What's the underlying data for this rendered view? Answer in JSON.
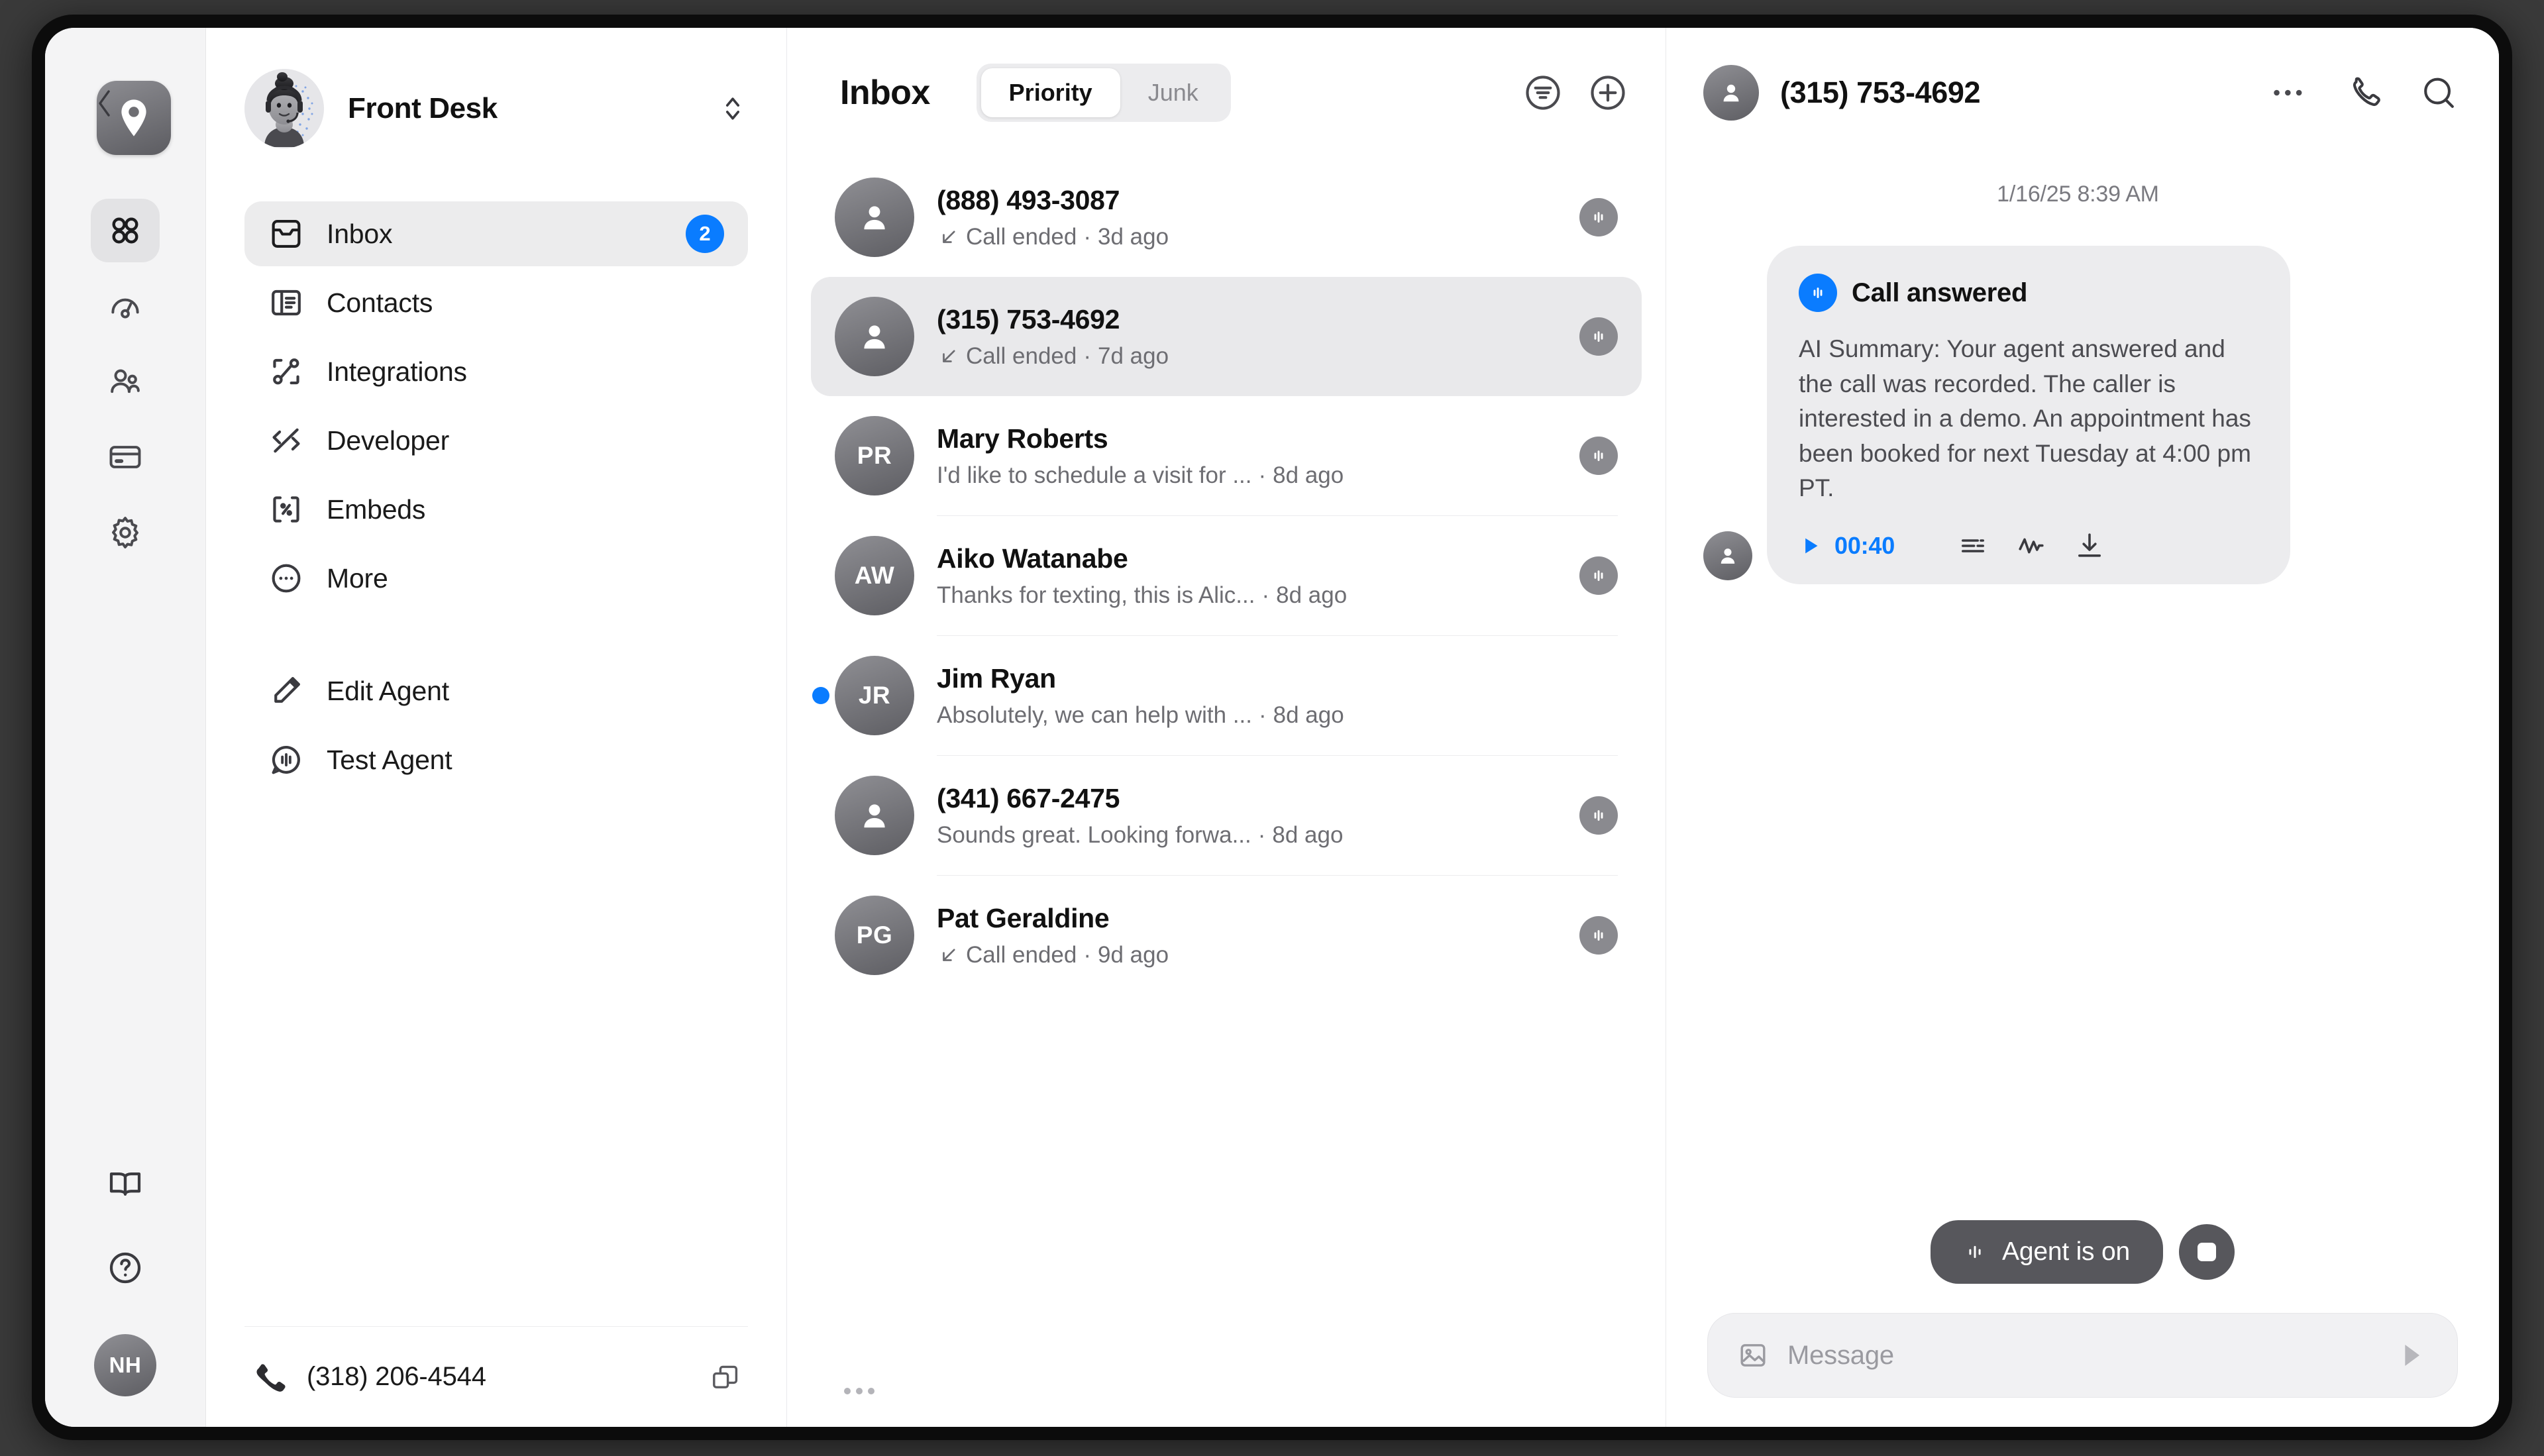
{
  "rail": {
    "back_label": "Back",
    "logo_icon": "location-pin-icon",
    "items": [
      {
        "name": "apps",
        "icon": "grid-apps-icon",
        "active": true
      },
      {
        "name": "analytics",
        "icon": "gauge-icon",
        "active": false
      },
      {
        "name": "team",
        "icon": "people-icon",
        "active": false
      },
      {
        "name": "billing",
        "icon": "credit-card-icon",
        "active": false
      },
      {
        "name": "settings",
        "icon": "gear-icon",
        "active": false
      }
    ],
    "bottom": [
      {
        "name": "docs",
        "icon": "book-icon"
      },
      {
        "name": "help",
        "icon": "question-circle-icon"
      }
    ],
    "user_initials": "NH"
  },
  "nav": {
    "title": "Front Desk",
    "avatar_alt": "agent-avatar",
    "sort_icon": "chevron-up-down-icon",
    "items": [
      {
        "label": "Inbox",
        "icon": "inbox-icon",
        "badge": "2",
        "active": true
      },
      {
        "label": "Contacts",
        "icon": "contacts-icon",
        "badge": "",
        "active": false
      },
      {
        "label": "Integrations",
        "icon": "integrations-icon",
        "badge": "",
        "active": false
      },
      {
        "label": "Developer",
        "icon": "code-icon",
        "badge": "",
        "active": false
      },
      {
        "label": "Embeds",
        "icon": "embed-icon",
        "badge": "",
        "active": false
      },
      {
        "label": "More",
        "icon": "ellipsis-circle-icon",
        "badge": "",
        "active": false
      }
    ],
    "secondary": [
      {
        "label": "Edit Agent",
        "icon": "pencil-icon"
      },
      {
        "label": "Test Agent",
        "icon": "chat-waveform-icon"
      }
    ],
    "footer": {
      "phone": "(318) 206-4544",
      "phone_icon": "phone-icon",
      "copy_icon": "copy-icon"
    }
  },
  "inbox": {
    "title": "Inbox",
    "tabs": [
      {
        "label": "Priority",
        "selected": true
      },
      {
        "label": "Junk",
        "selected": false
      }
    ],
    "filter_icon": "filter-circle-icon",
    "add_icon": "plus-circle-icon",
    "more_icon": "ellipsis-icon",
    "conversations": [
      {
        "name": "(888) 493-3087",
        "initials": "",
        "preview": "Call ended",
        "time": "3d ago",
        "call": true,
        "selected": false,
        "unread": false,
        "badge_icon": "waveform-icon",
        "divider": false
      },
      {
        "name": "(315) 753-4692",
        "initials": "",
        "preview": "Call ended",
        "time": "7d ago",
        "call": true,
        "selected": true,
        "unread": false,
        "badge_icon": "waveform-icon",
        "divider": false
      },
      {
        "name": "Mary Roberts",
        "initials": "PR",
        "preview": "I'd like to schedule a visit for ...",
        "time": "8d ago",
        "call": false,
        "selected": false,
        "unread": false,
        "badge_icon": "waveform-icon",
        "divider": true
      },
      {
        "name": "Aiko Watanabe",
        "initials": "AW",
        "preview": "Thanks for texting, this is Alic...",
        "time": "8d ago",
        "call": false,
        "selected": false,
        "unread": false,
        "badge_icon": "waveform-icon",
        "divider": true
      },
      {
        "name": "Jim Ryan",
        "initials": "JR",
        "preview": "Absolutely, we can help with ...",
        "time": "8d ago",
        "call": false,
        "selected": false,
        "unread": true,
        "badge_icon": "",
        "divider": true
      },
      {
        "name": "(341) 667-2475",
        "initials": "",
        "preview": "Sounds great. Looking forwa...",
        "time": "8d ago",
        "call": false,
        "selected": false,
        "unread": false,
        "badge_icon": "waveform-icon",
        "divider": true
      },
      {
        "name": "Pat Geraldine",
        "initials": "PG",
        "preview": "Call ended",
        "time": "9d ago",
        "call": true,
        "selected": false,
        "unread": false,
        "badge_icon": "waveform-icon",
        "divider": false
      }
    ]
  },
  "chat": {
    "title": "(315) 753-4692",
    "avatar_icon": "person-icon",
    "actions": [
      {
        "name": "more",
        "icon": "ellipsis-icon"
      },
      {
        "name": "call",
        "icon": "phone-icon"
      },
      {
        "name": "search",
        "icon": "search-icon"
      }
    ],
    "date_divider": "1/16/25 8:39 AM",
    "message": {
      "icon": "waveform-circle-icon",
      "title": "Call answered",
      "body": "AI Summary: Your agent answered and the call was recorded. The caller is interested in a demo. An appointment has been booked for next Tuesday at 4:00 pm PT.",
      "play_icon": "play-icon",
      "duration": "00:40",
      "transcript_icon": "transcript-icon",
      "waveform_icon": "audio-wave-icon",
      "download_icon": "download-icon"
    },
    "agent_toggle": {
      "label": "Agent is on",
      "icon": "waveform-icon"
    },
    "stop_button": "stop-icon",
    "composer": {
      "placeholder": "Message",
      "image_icon": "image-icon",
      "send_icon": "send-icon"
    }
  },
  "colors": {
    "accent": "#0a7cff",
    "rail_bg": "#f4f4f5",
    "selected_bg": "#e9e9eb",
    "bubble_bg": "#ececee",
    "dark_pill": "#57575c"
  }
}
